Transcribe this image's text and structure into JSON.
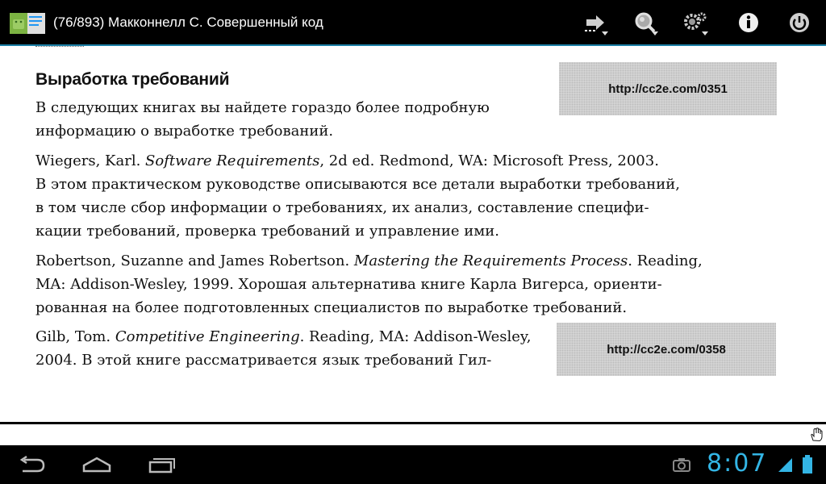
{
  "titlebar": {
    "title": "(76/893) Макконнелл С. Совершенный код"
  },
  "toolbar": {
    "icons": [
      "goto-icon",
      "search-icon",
      "settings-icon",
      "info-icon",
      "power-icon"
    ]
  },
  "content": {
    "heading": "Выработка требований",
    "intro": [
      "В следующих книгах вы найдете гораздо более подробную",
      "информацию о выработке требований."
    ],
    "ref1": {
      "line1_prefix": "Wiegers, Karl. ",
      "line1_italic": "Software Requirements",
      "line1_suffix": ", 2d ed. Redmond, WA: Microsoft Press, 2003.",
      "lines": [
        "В этом практическом руководстве описываются все детали выработки требований,",
        "в том числе сбор информации о требованиях, их анализ, составление специфи-",
        "кации требований, проверка требований и управление ими."
      ]
    },
    "ref2": {
      "line1_prefix": "Robertson, Suzanne and James Robertson. ",
      "line1_italic": "Mastering the Requirements Process",
      "line1_suffix": ". Reading,",
      "lines": [
        "MA: Addison-Wesley, 1999. Хорошая альтернатива книге Карла Вигерса, ориенти-",
        "рованная на более подготовленных специалистов по выработке требований."
      ]
    },
    "ref3": {
      "line1_prefix": "Gilb, Tom. ",
      "line1_italic": "Competitive Engineering",
      "line1_suffix": ". Reading, MA: Addison-Wesley,",
      "line2": "2004. В этой книге рассматривается язык требований Гил-"
    },
    "links": [
      "http://cc2e.com/0351",
      "http://cc2e.com/0358"
    ]
  },
  "statusbar": {
    "time": "8:07"
  },
  "colors": {
    "accent": "#33b5e5",
    "bar_line": "#1b7fa6"
  }
}
